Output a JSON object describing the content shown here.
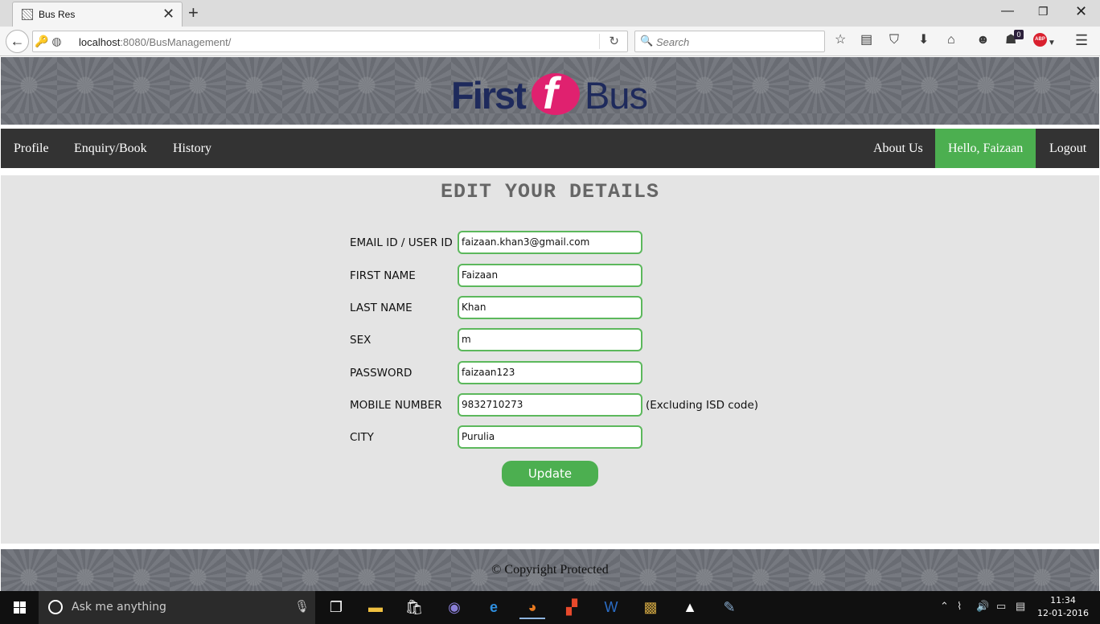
{
  "browser": {
    "tab_title": "Bus Res",
    "url_host": "localhost",
    "url_rest": ":8080/BusManagement/",
    "search_placeholder": "Search",
    "notification_count": "0",
    "adblock_label": "ABP"
  },
  "site": {
    "logo_first": "First",
    "logo_bus": "Bus",
    "nav_left": [
      "Profile",
      "Enquiry/Book",
      "History"
    ],
    "nav_right": [
      "About Us",
      "Hello, Faizaan",
      "Logout"
    ],
    "page_title": "EDIT YOUR DETAILS",
    "form": {
      "email_label": "EMAIL ID / USER ID",
      "email_value": "faizaan.khan3@gmail.com",
      "first_name_label": "FIRST NAME",
      "first_name_value": "Faizaan",
      "last_name_label": "LAST NAME",
      "last_name_value": "Khan",
      "sex_label": "SEX",
      "sex_value": "m",
      "password_label": "PASSWORD",
      "password_value": "faizaan123",
      "mobile_label": "MOBILE NUMBER",
      "mobile_value": "9832710273",
      "mobile_note": "(Excluding ISD code)",
      "city_label": "CITY",
      "city_value": "Purulia",
      "update_label": "Update"
    },
    "footer": "© Copyright Protected",
    "colors": {
      "accent_green": "#4caf50",
      "menubar": "#333333",
      "logo_pink": "#e0216f",
      "logo_navy": "#1e2a5c"
    }
  },
  "taskbar": {
    "search_placeholder": "Ask me anything",
    "time": "11:34",
    "date": "12-01-2016"
  }
}
